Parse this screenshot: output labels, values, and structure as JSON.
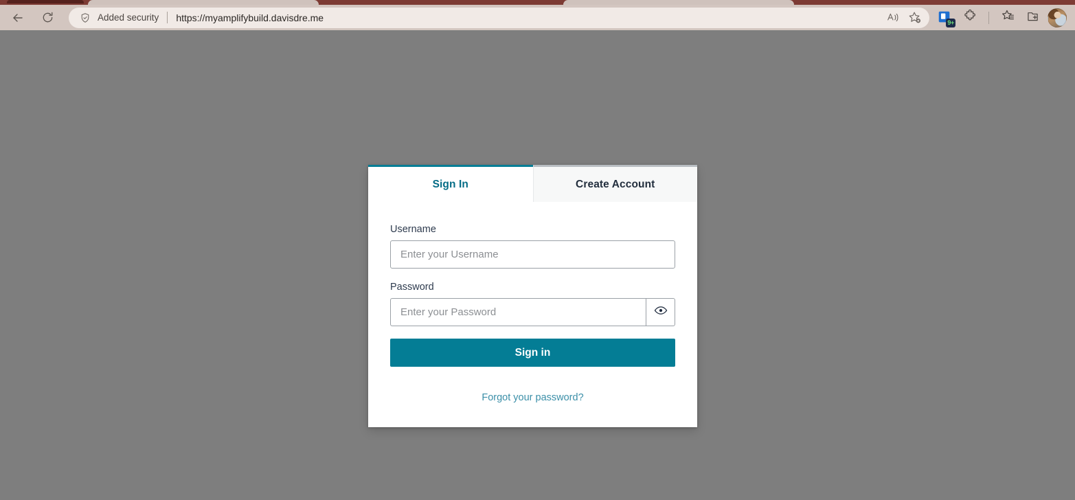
{
  "browser": {
    "back_label": "Back",
    "refresh_label": "Refresh",
    "security_badge": "Added security",
    "url": "https://myamplifybuild.davisdre.me",
    "read_aloud_label": "Read aloud",
    "add_favorite_label": "Add this page to favorites",
    "extension_badge_count": "9+",
    "extensions_label": "Extensions",
    "favorites_label": "Favorites",
    "collections_label": "Collections",
    "profile_label": "Profile"
  },
  "auth": {
    "tabs": [
      {
        "label": "Sign In",
        "active": true
      },
      {
        "label": "Create Account",
        "active": false
      }
    ],
    "username": {
      "label": "Username",
      "placeholder": "Enter your Username",
      "value": ""
    },
    "password": {
      "label": "Password",
      "placeholder": "Enter your Password",
      "value": "",
      "toggle_label": "Show password"
    },
    "submit_label": "Sign in",
    "forgot_label": "Forgot your password?"
  },
  "colors": {
    "accent": "#047d95",
    "accent_text": "#046c86",
    "link": "#3b8fa8",
    "page_bg": "#7e7e7e",
    "card_bg": "#ffffff",
    "inactive_tab_bg": "#f7f8f8",
    "label_text": "#2e3b4e"
  }
}
